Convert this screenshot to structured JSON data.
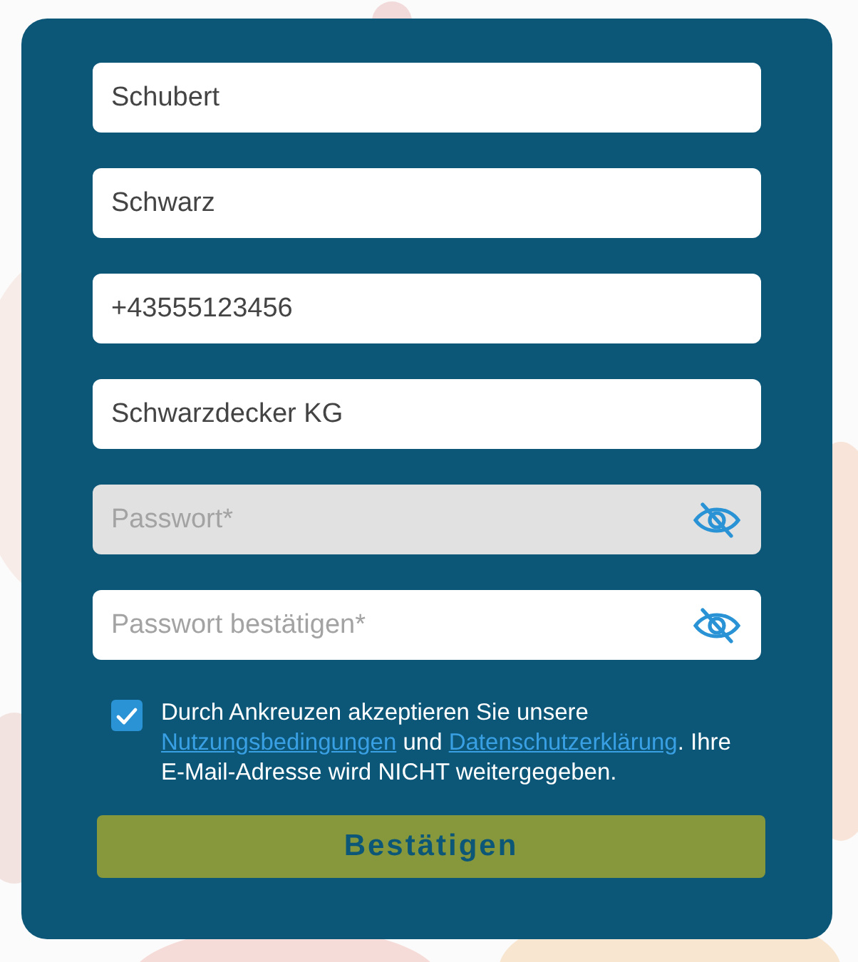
{
  "fields": [
    {
      "kind": "text",
      "value": "Schubert",
      "disabled": false
    },
    {
      "kind": "text",
      "value": "Schwarz",
      "disabled": false
    },
    {
      "kind": "text",
      "value": "+43555123456",
      "disabled": false
    },
    {
      "kind": "text",
      "value": "Schwarzdecker KG",
      "disabled": false
    },
    {
      "kind": "password",
      "placeholder": "Passwort*",
      "disabled": true
    },
    {
      "kind": "password",
      "placeholder": "Passwort bestätigen*",
      "disabled": false
    }
  ],
  "consent": {
    "checked": true,
    "parts": [
      {
        "kind": "text",
        "text": "Durch Ankreuzen akzeptieren Sie unsere "
      },
      {
        "kind": "link",
        "text": "Nutzungsbedingungen"
      },
      {
        "kind": "text",
        "text": " und "
      },
      {
        "kind": "link",
        "text": "Datenschutzerklärung"
      },
      {
        "kind": "text",
        "text": ". Ihre E-Mail-Adresse wird NICHT weitergegeben."
      }
    ]
  },
  "submit": {
    "label": "Bestätigen"
  }
}
